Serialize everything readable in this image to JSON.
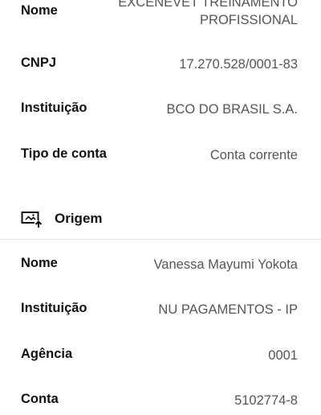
{
  "destino": {
    "nome_label": "Nome",
    "nome_value_line1": "EXCENEVET TREINAMENTO",
    "nome_value_line2": "PROFISSIONAL",
    "cnpj_label": "CNPJ",
    "cnpj_value": "17.270.528/0001-83",
    "instituicao_label": "Instituição",
    "instituicao_value": "BCO DO BRASIL S.A.",
    "tipo_conta_label": "Tipo de conta",
    "tipo_conta_value": "Conta corrente"
  },
  "origem": {
    "section_title": "Origem",
    "icon": "upload-screen-icon",
    "nome_label": "Nome",
    "nome_value": "Vanessa Mayumi Yokota",
    "instituicao_label": "Instituição",
    "instituicao_value": "NU PAGAMENTOS - IP",
    "agencia_label": "Agência",
    "agencia_value": "0001",
    "conta_label": "Conta",
    "conta_value": "5102774-8"
  }
}
